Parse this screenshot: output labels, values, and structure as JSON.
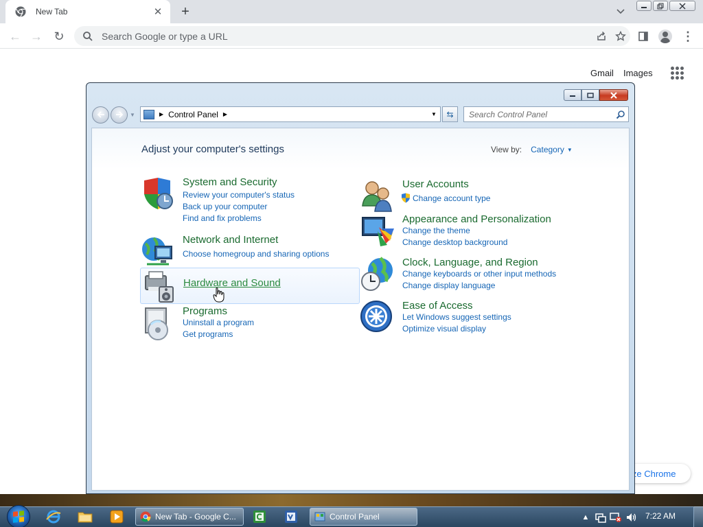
{
  "chrome": {
    "tab_title": "New Tab",
    "tab_close": "✕",
    "new_tab": "+",
    "back": "←",
    "forward": "→",
    "reload": "↻",
    "omnibox_placeholder": "Search Google or type a URL",
    "menu": "⋮"
  },
  "google_links": {
    "gmail": "Gmail",
    "images": "Images"
  },
  "customize_chrome": "ize Chrome",
  "control_panel": {
    "breadcrumb": "Control Panel",
    "search_placeholder": "Search Control Panel",
    "heading": "Adjust your computer's settings",
    "view_by_label": "View by:",
    "view_by_value": "Category",
    "categories_left": [
      {
        "title": "System and Security",
        "links": [
          "Review your computer's status",
          "Back up your computer",
          "Find and fix problems"
        ]
      },
      {
        "title": "Network and Internet",
        "links": [
          "Choose homegroup and sharing options"
        ]
      },
      {
        "title": "Hardware and Sound",
        "links": []
      },
      {
        "title": "Programs",
        "links": [
          "Uninstall a program",
          "Get programs"
        ]
      }
    ],
    "categories_right": [
      {
        "title": "User Accounts",
        "links": [
          "Change account type"
        ]
      },
      {
        "title": "Appearance and Personalization",
        "links": [
          "Change the theme",
          "Change desktop background"
        ]
      },
      {
        "title": "Clock, Language, and Region",
        "links": [
          "Change keyboards or other input methods",
          "Change display language"
        ]
      },
      {
        "title": "Ease of Access",
        "links": [
          "Let Windows suggest settings",
          "Optimize visual display"
        ]
      }
    ]
  },
  "taskbar": {
    "tasks": [
      "New Tab - Google C...",
      "Control Panel"
    ],
    "clock": "7:22 AM",
    "tray_arrow": "▲"
  },
  "colors": {
    "category_title": "#1a6a2f",
    "link": "#1565b5",
    "hover_border": "#b8d6fb"
  }
}
